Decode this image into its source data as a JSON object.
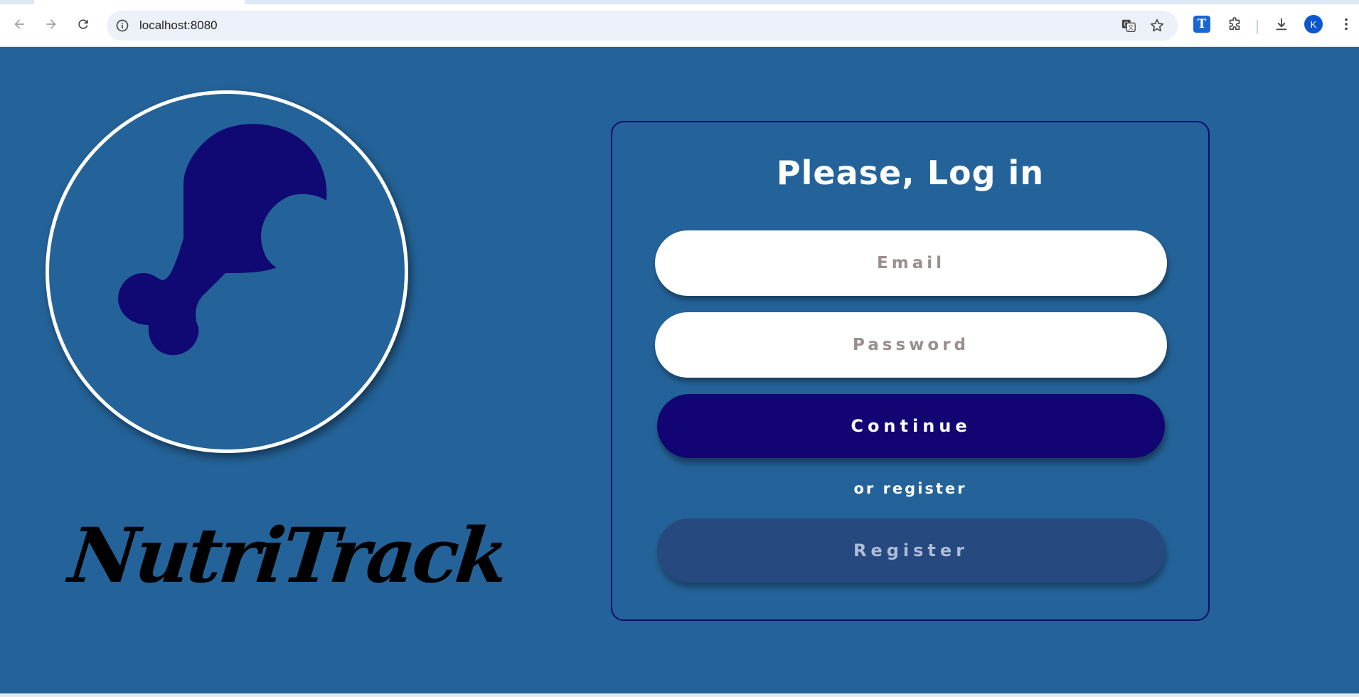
{
  "browser": {
    "url": "localhost:8080",
    "profile_initial": "K",
    "extension_label": "T"
  },
  "logo": {
    "icon": "chicken-drumstick-icon",
    "fill_color": "#100873",
    "ring_color": "#ffffff"
  },
  "brand": {
    "name": "NutriTrack"
  },
  "login": {
    "title": "Please, Log in",
    "email_placeholder": "Email",
    "password_placeholder": "Password",
    "continue_label": "Continue",
    "or_text": "or register",
    "register_label": "Register"
  },
  "colors": {
    "background": "#246399",
    "primary_button": "#120573",
    "secondary_button": "#26497f",
    "card_border": "#0c0a6e"
  }
}
